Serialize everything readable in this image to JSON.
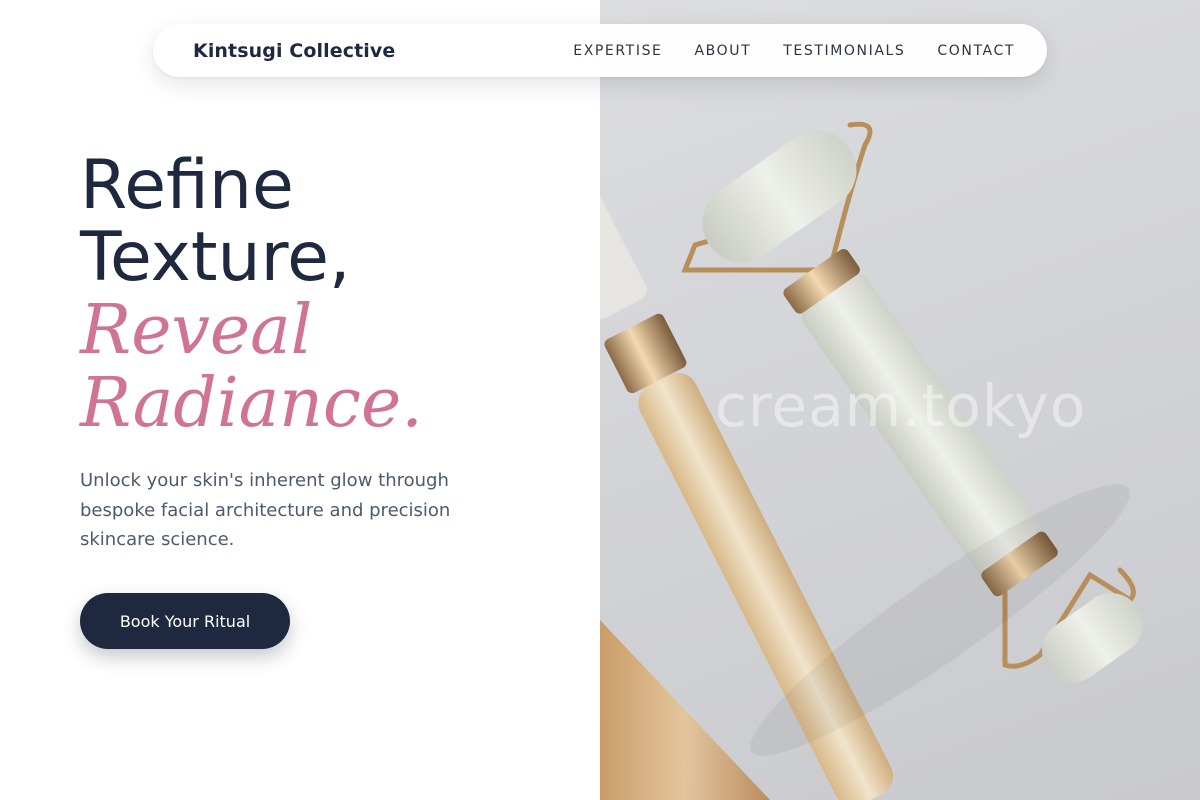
{
  "nav": {
    "brand": "Kintsugi Collective",
    "links": [
      "EXPERTISE",
      "ABOUT",
      "TESTIMONIALS",
      "CONTACT"
    ]
  },
  "hero": {
    "headline_line1": "Refine",
    "headline_line2": "Texture,",
    "headline_accent1": "Reveal",
    "headline_accent2": "Radiance.",
    "subtitle": "Unlock your skin's inherent glow through bespoke facial architecture and precision skincare science.",
    "cta_label": "Book Your Ritual",
    "image_watermark": "cream.tokyo"
  },
  "colors": {
    "navy": "#1e2940",
    "accent_pink": "#d07394",
    "body_text": "#4d5a6d"
  }
}
